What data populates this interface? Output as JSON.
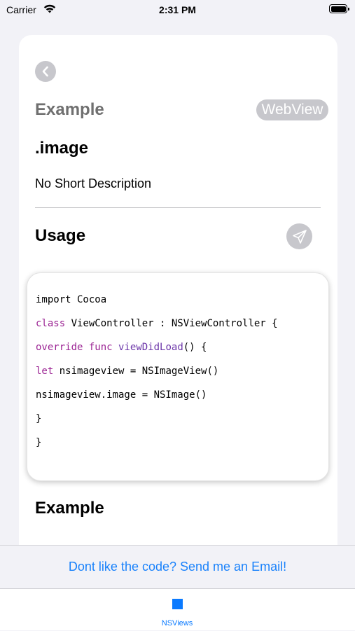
{
  "status_bar": {
    "carrier": "Carrier",
    "time": "2:31 PM"
  },
  "header": {
    "section_title": "Example",
    "badge": "WebView"
  },
  "item": {
    "title": ".image",
    "short_description": "No Short Description"
  },
  "usage": {
    "title": "Usage"
  },
  "code": {
    "lines": [
      [
        {
          "t": "import Cocoa",
          "c": "plain"
        }
      ],
      [
        {
          "t": "class",
          "c": "kw"
        },
        {
          "t": " ViewController : NSViewController {",
          "c": "plain"
        }
      ],
      [
        {
          "t": "override",
          "c": "kw"
        },
        {
          "t": " ",
          "c": "plain"
        },
        {
          "t": "func",
          "c": "kw"
        },
        {
          "t": " ",
          "c": "plain"
        },
        {
          "t": "viewDidLoad",
          "c": "fn"
        },
        {
          "t": "() {",
          "c": "plain"
        }
      ],
      [
        {
          "t": "let",
          "c": "kw"
        },
        {
          "t": " nsimageview = NSImageView()",
          "c": "plain"
        }
      ],
      [
        {
          "t": "nsimageview.image = NSImage()",
          "c": "plain"
        }
      ],
      [
        {
          "t": "}",
          "c": "plain"
        }
      ],
      [
        {
          "t": "}",
          "c": "plain"
        }
      ]
    ]
  },
  "example": {
    "title": "Example"
  },
  "email_bar": {
    "link_text": "Dont like the code? Send me an Email!"
  },
  "tab_bar": {
    "items": [
      {
        "label": "NSViews",
        "icon": "square-icon",
        "selected": true
      }
    ]
  },
  "colors": {
    "accent": "#0a7aff",
    "keyword": "#9b2393",
    "function": "#6c36a9",
    "disabled": "#c7c7cc"
  }
}
